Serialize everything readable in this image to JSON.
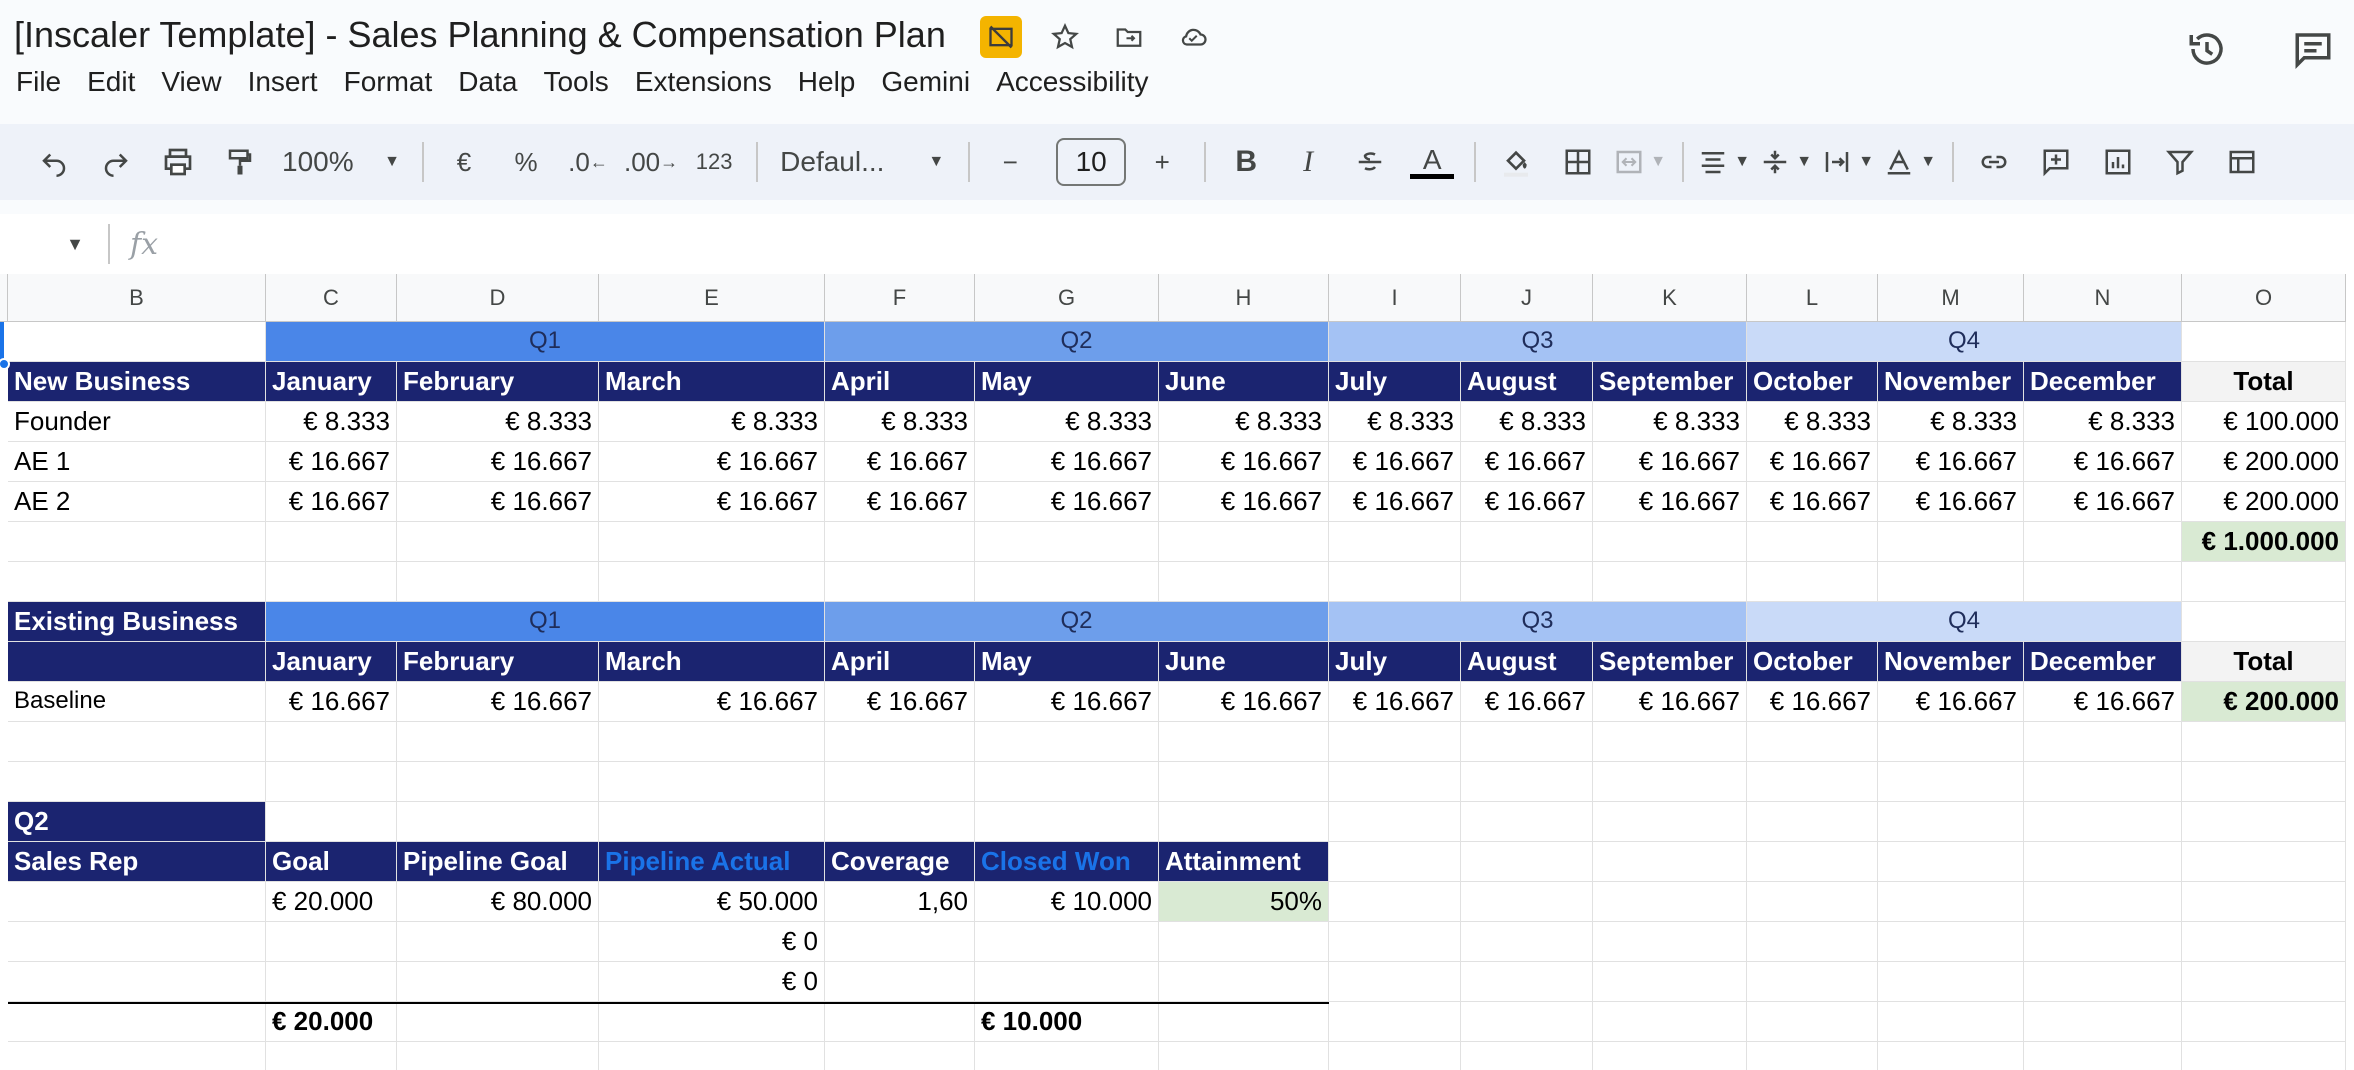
{
  "app": {
    "doc_title": "[Inscaler Template]  - Sales Planning & Compensation Plan",
    "menu": [
      "File",
      "Edit",
      "View",
      "Insert",
      "Format",
      "Data",
      "Tools",
      "Extensions",
      "Help",
      "Gemini",
      "Accessibility"
    ]
  },
  "toolbar": {
    "zoom": "100%",
    "currency": "€",
    "percent": "%",
    "dec_decrease": ".0",
    "dec_increase": ".00",
    "number_format": "123",
    "font": "Defaul...",
    "font_size": "10",
    "minus": "−",
    "plus": "+",
    "bold": "B",
    "italic": "I",
    "text_color": "A"
  },
  "formula": {
    "fx": "fx",
    "value": ""
  },
  "columns": [
    "B",
    "C",
    "D",
    "E",
    "F",
    "G",
    "H",
    "I",
    "J",
    "K",
    "L",
    "M",
    "N",
    "O"
  ],
  "quarters": [
    "Q1",
    "Q2",
    "Q3",
    "Q4"
  ],
  "months": [
    "January",
    "February",
    "March",
    "April",
    "May",
    "June",
    "July",
    "August",
    "September",
    "October",
    "November",
    "December"
  ],
  "total_label": "Total",
  "new_business": {
    "label": "New Business",
    "rows": [
      {
        "name": "Founder",
        "values": [
          "€ 8.333",
          "€ 8.333",
          "€ 8.333",
          "€ 8.333",
          "€ 8.333",
          "€ 8.333",
          "€ 8.333",
          "€ 8.333",
          "€ 8.333",
          "€ 8.333",
          "€ 8.333",
          "€ 8.333"
        ],
        "total": "€ 100.000"
      },
      {
        "name": "AE 1",
        "values": [
          "€ 16.667",
          "€ 16.667",
          "€ 16.667",
          "€ 16.667",
          "€ 16.667",
          "€ 16.667",
          "€ 16.667",
          "€ 16.667",
          "€ 16.667",
          "€ 16.667",
          "€ 16.667",
          "€ 16.667"
        ],
        "total": "€ 200.000"
      },
      {
        "name": "AE 2",
        "values": [
          "€ 16.667",
          "€ 16.667",
          "€ 16.667",
          "€ 16.667",
          "€ 16.667",
          "€ 16.667",
          "€ 16.667",
          "€ 16.667",
          "€ 16.667",
          "€ 16.667",
          "€ 16.667",
          "€ 16.667"
        ],
        "total": "€ 200.000"
      }
    ],
    "grand_total": "€ 1.000.000"
  },
  "existing_business": {
    "label": "Existing Business",
    "rows": [
      {
        "name": "Baseline",
        "values": [
          "€ 16.667",
          "€ 16.667",
          "€ 16.667",
          "€ 16.667",
          "€ 16.667",
          "€ 16.667",
          "€ 16.667",
          "€ 16.667",
          "€ 16.667",
          "€ 16.667",
          "€ 16.667",
          "€ 16.667"
        ],
        "total": "€ 200.000"
      }
    ]
  },
  "q2_table": {
    "title": "Q2",
    "headers": [
      "Sales Rep",
      "Goal",
      "Pipeline Goal",
      "Pipeline Actual",
      "Coverage",
      "Closed Won",
      "Attainment"
    ],
    "row1": {
      "goal": "€ 20.000",
      "pipeline_goal": "€ 80.000",
      "pipeline_actual": "€ 50.000",
      "coverage": "1,60",
      "closed_won": "€ 10.000",
      "attainment": "50%"
    },
    "row2": {
      "pipeline_actual": "€ 0"
    },
    "row3": {
      "pipeline_actual": "€ 0"
    },
    "totals": {
      "goal": "€ 20.000",
      "closed_won": "€ 10.000"
    }
  },
  "colors": {
    "navy": "#1b2470",
    "q1": "#4a86e8",
    "q2": "#6d9eeb",
    "q3": "#a4c2f4",
    "q4": "#c9daf8",
    "green": "#d9ead3",
    "accent": "#1a73e8"
  }
}
